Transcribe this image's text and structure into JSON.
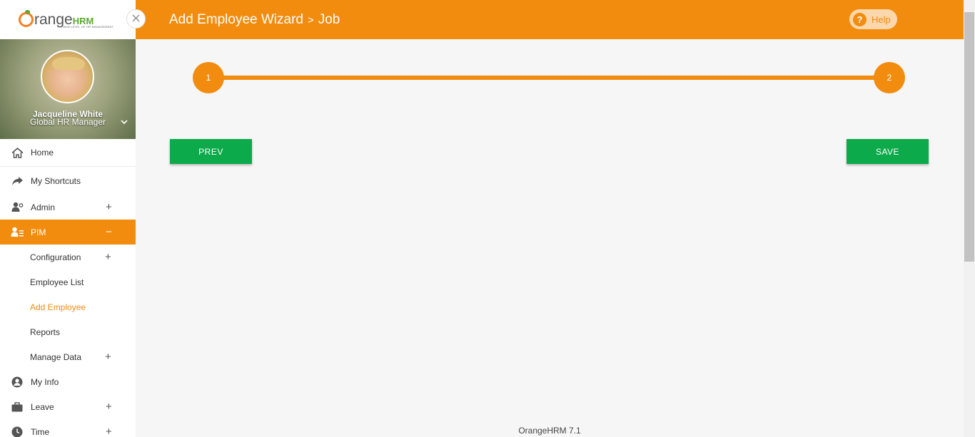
{
  "brand": {
    "name_main": "range",
    "name_hrm": "HRM",
    "tagline": "NEW LEVEL OF HR MANAGEMENT"
  },
  "sidebar": {
    "close_icon": "close-icon",
    "profile": {
      "name": "Jacqueline White",
      "role": "Global HR Manager"
    },
    "items": [
      {
        "label": "Home",
        "icon": "home-icon"
      },
      {
        "label": "My Shortcuts",
        "icon": "share-icon"
      },
      {
        "label": "Admin",
        "icon": "admin-icon",
        "toggle": "+"
      },
      {
        "label": "PIM",
        "icon": "pim-icon",
        "toggle": "−"
      },
      {
        "label": "My Info",
        "icon": "user-circle-icon"
      },
      {
        "label": "Leave",
        "icon": "briefcase-icon",
        "toggle": "+"
      },
      {
        "label": "Time",
        "icon": "clock-icon",
        "toggle": "+"
      }
    ],
    "pim_submenu": [
      {
        "label": "Configuration",
        "toggle": "+"
      },
      {
        "label": "Employee List"
      },
      {
        "label": "Add Employee"
      },
      {
        "label": "Reports"
      },
      {
        "label": "Manage Data",
        "toggle": "+"
      }
    ]
  },
  "header": {
    "title": "Add Employee Wizard",
    "separator": ">",
    "subtitle": "Job",
    "help_label": "Help",
    "help_icon_glyph": "?"
  },
  "wizard": {
    "steps": [
      "1",
      "2"
    ],
    "prev_label": "PREV",
    "save_label": "SAVE"
  },
  "footer": {
    "version": "OrangeHRM 7.1"
  },
  "colors": {
    "accent": "#f28c0f",
    "button_green": "#0caa4a"
  }
}
